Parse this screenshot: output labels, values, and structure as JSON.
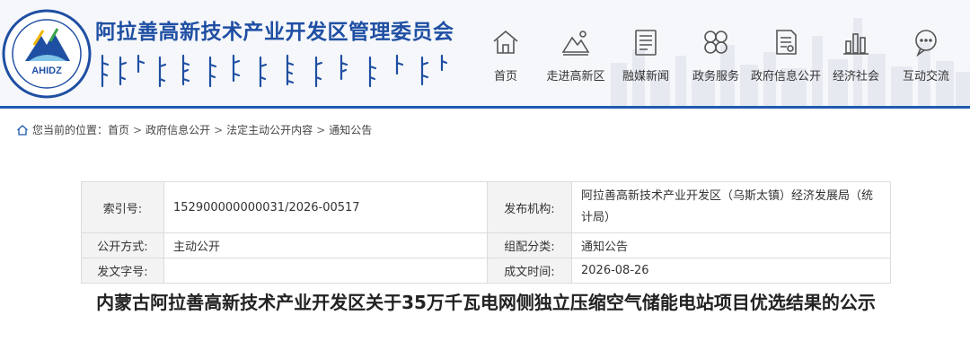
{
  "header": {
    "logo_text": "AHIDZ",
    "site_title": "阿拉善高新技术产业开发区管理委员会",
    "brand_color": "#1f4fa3"
  },
  "nav": {
    "items": [
      {
        "label": "首页",
        "icon": "home-icon"
      },
      {
        "label": "走进高新区",
        "icon": "mountain-icon"
      },
      {
        "label": "融媒新闻",
        "icon": "news-icon"
      },
      {
        "label": "政务服务",
        "icon": "service-grid-icon"
      },
      {
        "label": "政府信息公开",
        "icon": "document-icon"
      },
      {
        "label": "经济社会",
        "icon": "bar-chart-icon"
      },
      {
        "label": "互动交流",
        "icon": "chat-icon"
      }
    ]
  },
  "breadcrumb": {
    "prefix": "您当前的位置：",
    "items": [
      "首页",
      "政府信息公开",
      "法定主动公开内容",
      "通知公告"
    ],
    "separator": ">"
  },
  "meta": {
    "index_label": "索引号:",
    "index_value": "152900000000031/2026-00517",
    "publisher_label": "发布机构:",
    "publisher_value": "阿拉善高新技术产业开发区（乌斯太镇）经济发展局（统计局）",
    "method_label": "公开方式:",
    "method_value": "主动公开",
    "category_label": "组配分类:",
    "category_value": "通知公告",
    "docno_label": "发文字号:",
    "docno_value": "",
    "date_label": "成文时间:",
    "date_value": "2026-08-26"
  },
  "article": {
    "title": "内蒙古阿拉善高新技术产业开发区关于35万千瓦电网侧独立压缩空气储能电站项目优选结果的公示"
  }
}
